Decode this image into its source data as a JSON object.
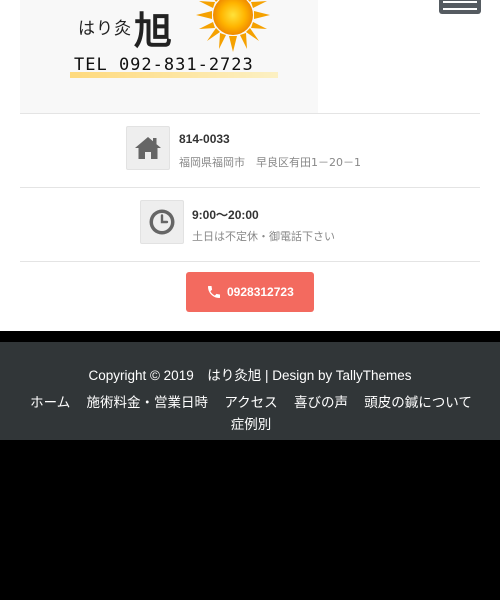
{
  "logo": {
    "name_small": "はり灸",
    "name_big": "旭",
    "tel": "TEL 092-831-2723"
  },
  "menu_toggle": {
    "icon": "hamburger-icon"
  },
  "address": {
    "icon": "home-icon",
    "postal": "814-0033",
    "street": "福岡県福岡市　早良区有田1－20－1"
  },
  "hours": {
    "icon": "clock-icon",
    "time": "9:00〜20:00",
    "note": "土日は不定休・御電話下さい"
  },
  "phone_button": {
    "icon": "phone-icon",
    "label": "0928312723"
  },
  "footer": {
    "copyright": "Copyright © 2019　はり灸旭 | Design by TallyThemes",
    "nav": [
      "ホーム",
      "施術料金・営業日時",
      "アクセス",
      "喜びの声",
      "頭皮の鍼について",
      "症例別"
    ]
  },
  "colors": {
    "accent": "#f36a5f",
    "footer_bg": "#313638",
    "icon_bg": "#eeeeee"
  }
}
